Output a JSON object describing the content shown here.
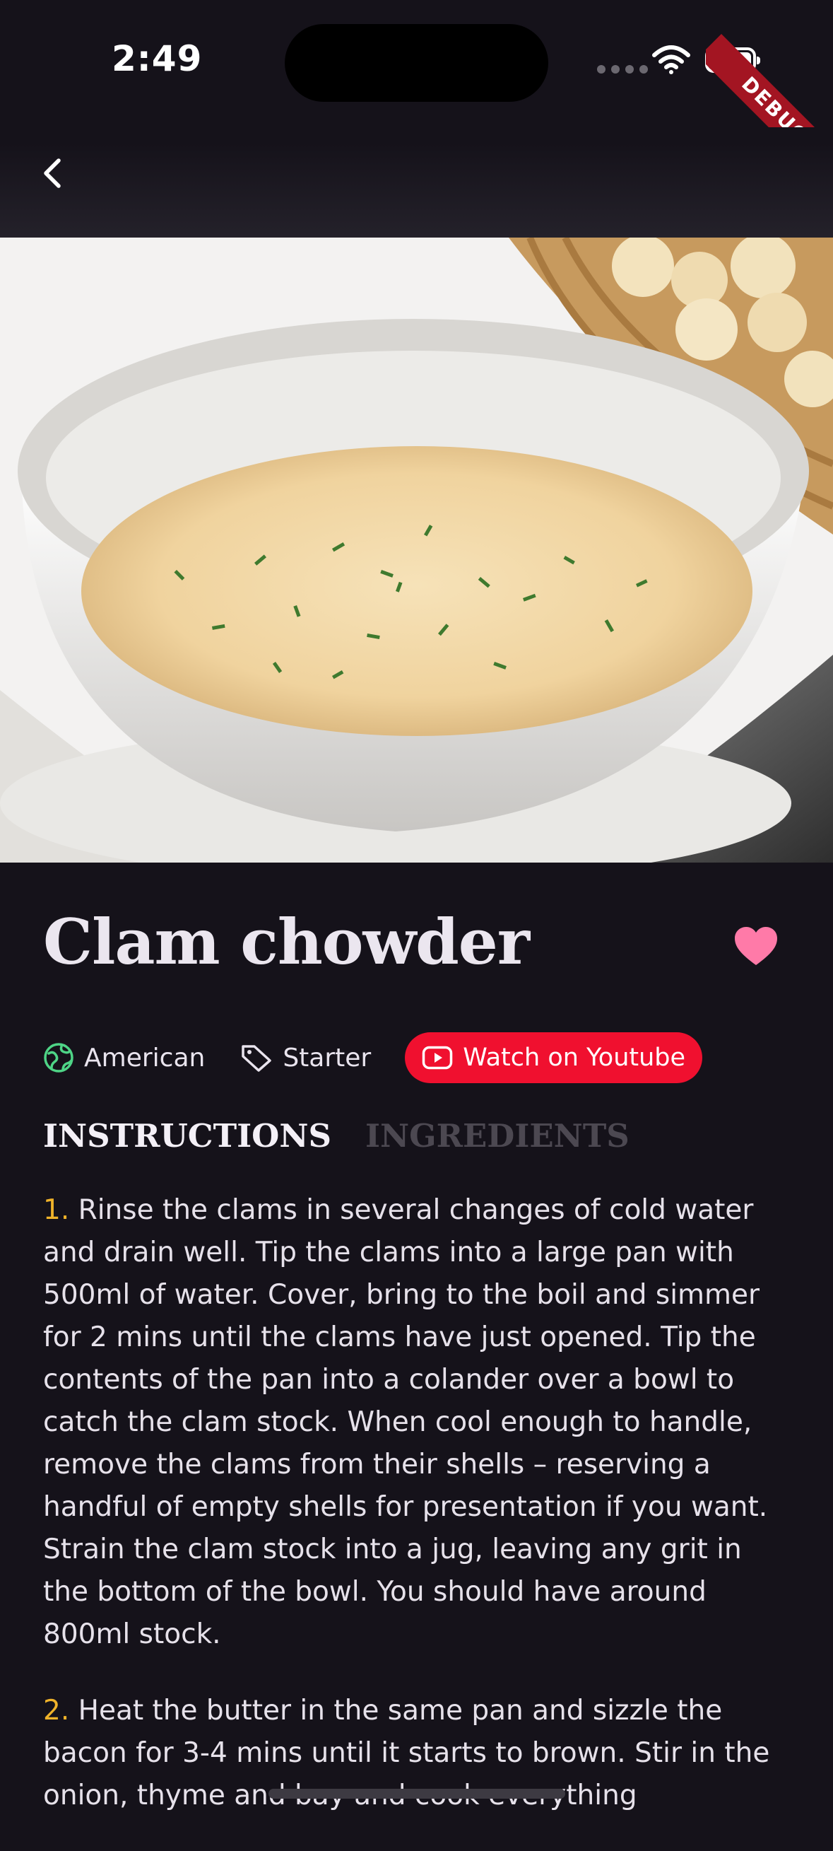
{
  "status_bar": {
    "time": "2:49",
    "debug_label": "DEBUG"
  },
  "app_bar": {
    "back_icon": "chevron-left-icon"
  },
  "recipe": {
    "title": "Clam chowder",
    "area": "American",
    "category": "Starter",
    "youtube_label": "Watch on Youtube",
    "favorite": true,
    "colors": {
      "favorite": "#ff7aa8",
      "youtube": "#f0102f",
      "step_number": "#f0b32a",
      "area_icon": "#4ed486"
    }
  },
  "tabs": [
    {
      "label": "INSTRUCTIONS",
      "active": true
    },
    {
      "label": "INGREDIENTS",
      "active": false
    }
  ],
  "steps": [
    {
      "num": "1.",
      "text": "Rinse the clams in several changes of cold water and drain well. Tip the clams into a large pan with 500ml of water. Cover, bring to the boil and simmer for 2 mins until the clams have just opened. Tip the contents of the pan into a colander over a bowl to catch the clam stock. When cool enough to handle, remove the clams from their shells – reserving a handful of empty shells for presentation if you want. Strain the clam stock into a jug, leaving any grit in the bottom of the bowl. You should have around 800ml stock."
    },
    {
      "num": "2.",
      "text": "Heat the butter in the same pan and sizzle the bacon for 3-4 mins until it starts to brown. Stir in the onion, thyme and bay and cook everything"
    }
  ]
}
